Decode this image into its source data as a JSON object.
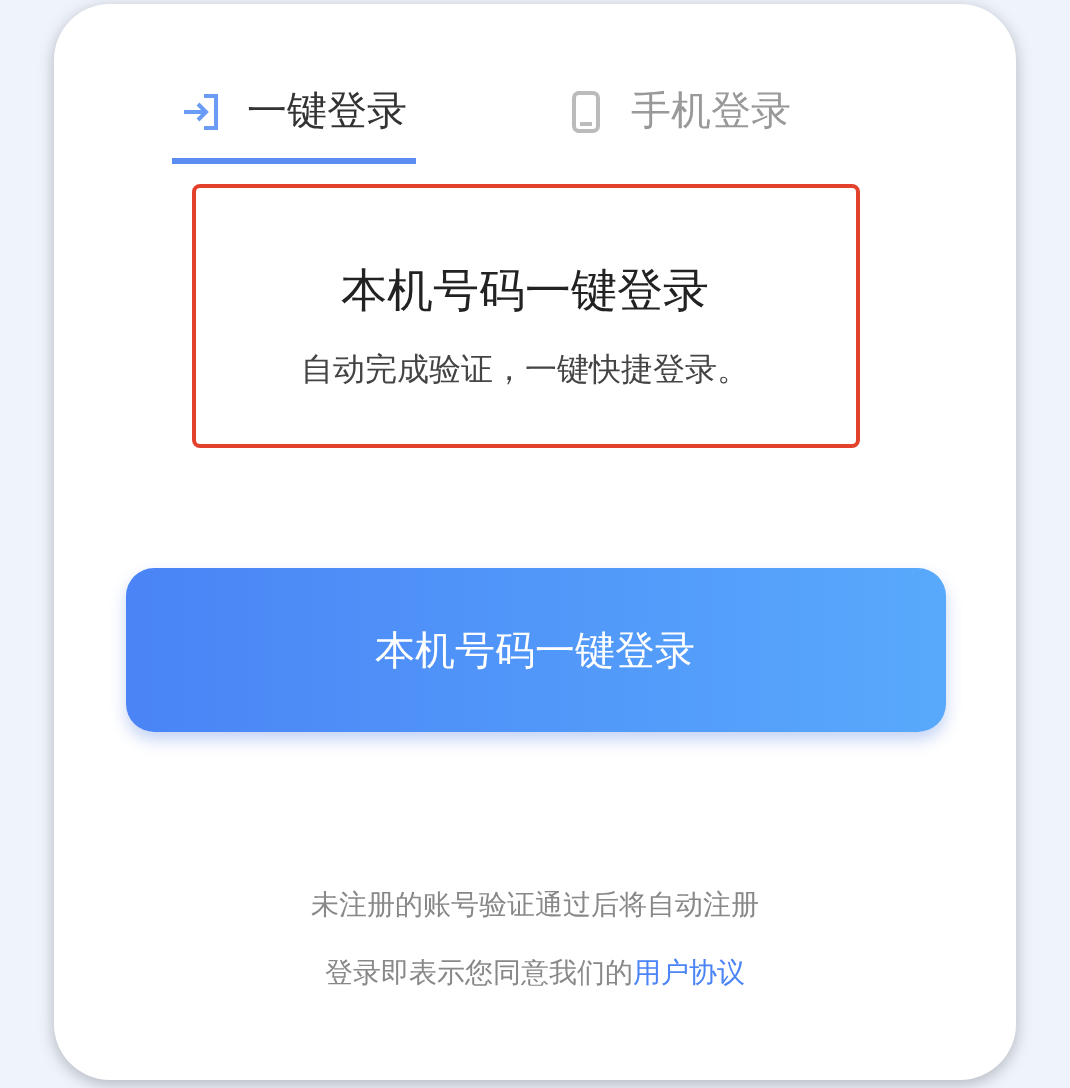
{
  "tabs": [
    {
      "label": "一键登录",
      "kind": "enter",
      "selected": true
    },
    {
      "label": "手机登录",
      "kind": "phone",
      "selected": false
    }
  ],
  "title": "本机号码一键登录",
  "subtitle": "自动完成验证，一键快捷登录。",
  "login_button": "本机号码一键登录",
  "notice": "未注册的账号验证通过后将自动注册",
  "agreement": {
    "text": "登录即表示您同意我们的",
    "link": "用户协议"
  }
}
